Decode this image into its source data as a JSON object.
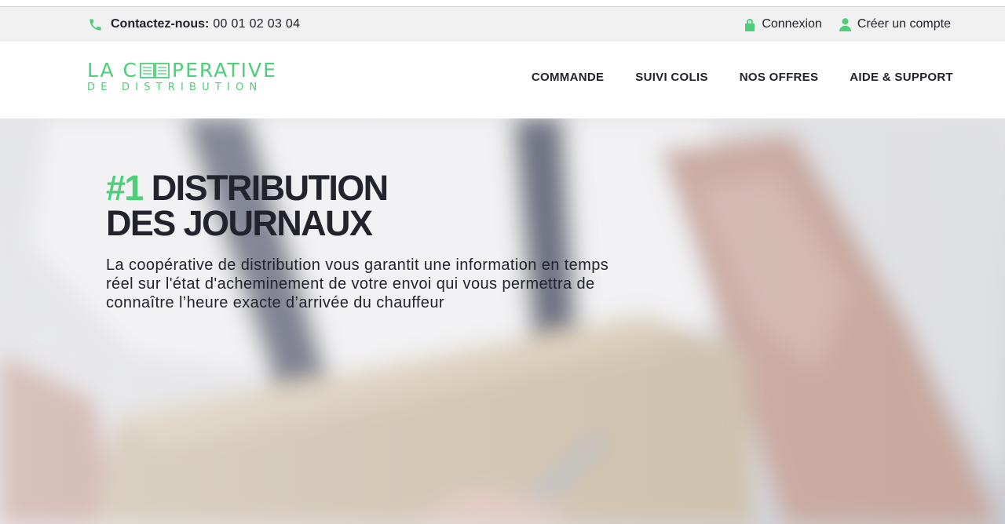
{
  "topbar": {
    "contact_label": "Contactez-nous:",
    "contact_phone": "00 01 02 03 04",
    "login_label": "Connexion",
    "register_label": "Créer un compte"
  },
  "logo": {
    "line1_left": "LA C",
    "line1_right": "PERATIVE",
    "line2": "DE DISTRIBUTION"
  },
  "nav": {
    "items": [
      {
        "label": "COMMANDE"
      },
      {
        "label": "SUIVI COLIS"
      },
      {
        "label": "NOS OFFRES"
      },
      {
        "label": "AIDE & SUPPORT"
      }
    ]
  },
  "hero": {
    "title_accent": "#1",
    "title_line1": "DISTRIBUTION",
    "title_line2": "DES JOURNAUX",
    "text": "La coopérative de distribution vous garantit une information en temps réel sur l'état d'acheminement de votre envoi qui vous permettra de connaître l’heure exacte d’arrivée du chauffeur"
  },
  "colors": {
    "accent": "#4ccf78",
    "text": "#23232e",
    "topbar_bg": "#f1f1f1"
  },
  "icons": {
    "phone": "phone-icon",
    "login": "lock-icon",
    "register": "user-icon"
  }
}
